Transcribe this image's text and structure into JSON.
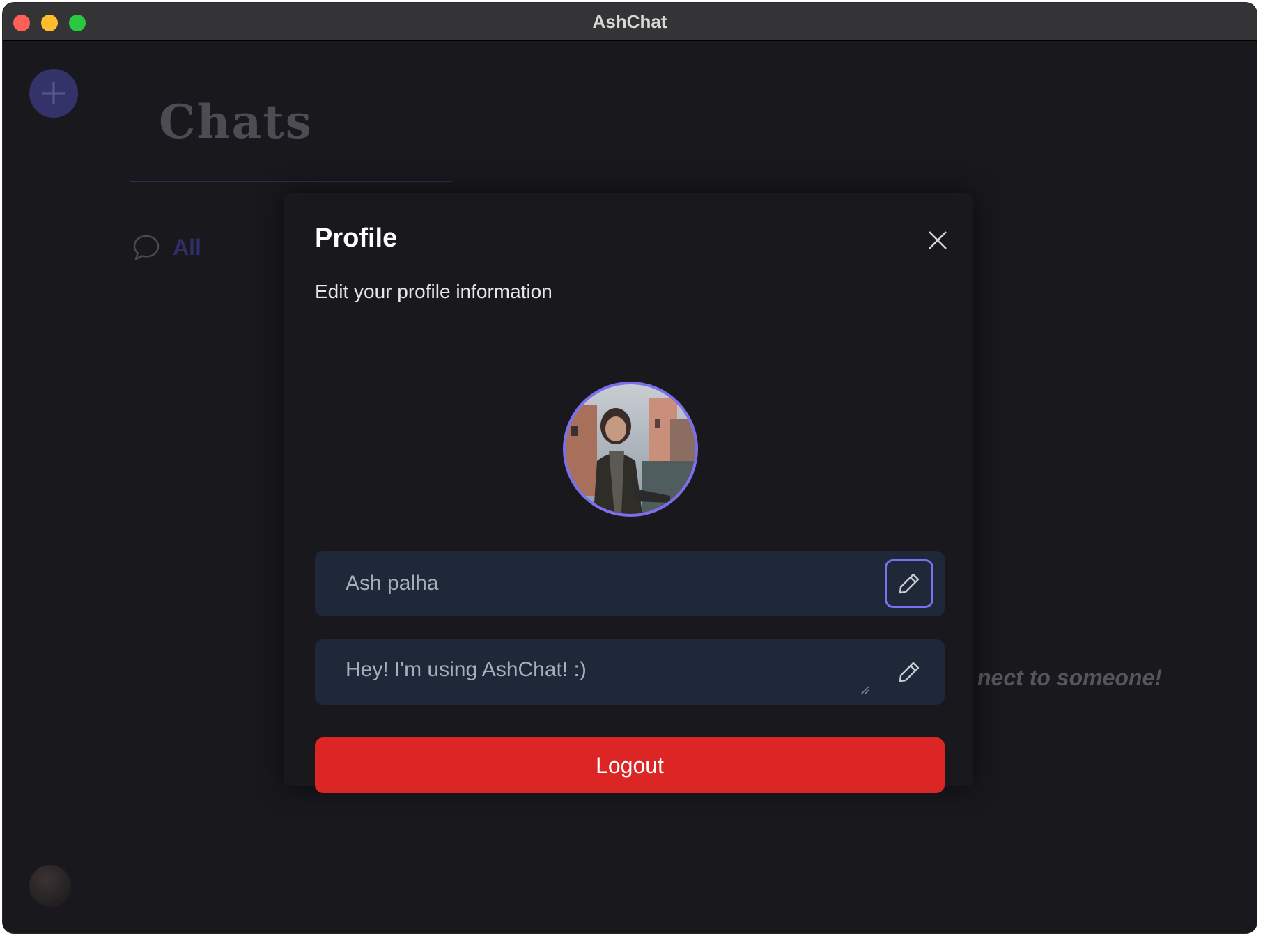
{
  "window": {
    "title": "AshChat"
  },
  "sidebar": {
    "add_icon": "plus-icon"
  },
  "chats_panel": {
    "title": "Chats",
    "filters": [
      {
        "label": "All",
        "icon": "chat-bubble-icon"
      }
    ],
    "empty_hint": "nect to someone!"
  },
  "profile_modal": {
    "title": "Profile",
    "subtitle": "Edit your profile information",
    "name_value": "Ash palha",
    "status_value": "Hey! I'm using AshChat! :)",
    "logout_label": "Logout",
    "close_icon": "close-icon",
    "edit_icon": "pencil-icon"
  },
  "colors": {
    "accent": "#7b6ff0",
    "logout": "#dc2626",
    "background": "#18181d",
    "field_bg": "#1f2838"
  }
}
